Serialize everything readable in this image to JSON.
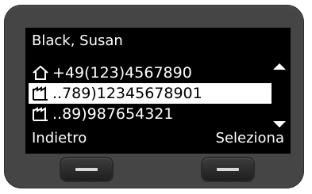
{
  "screen": {
    "title": "Black, Susan",
    "entries": [
      {
        "icon": "home-icon",
        "number": "+49(123)4567890",
        "selected": false
      },
      {
        "icon": "office-icon",
        "number": "..789)12345678901",
        "selected": true
      },
      {
        "icon": "office-icon",
        "number": "..89)987654321",
        "selected": false
      }
    ],
    "softkeys": {
      "left": "Indietro",
      "right": "Seleziona"
    }
  },
  "colors": {
    "body": "#454545",
    "screen": "#000000",
    "text": "#ffffff",
    "selection": "#ffffff"
  }
}
